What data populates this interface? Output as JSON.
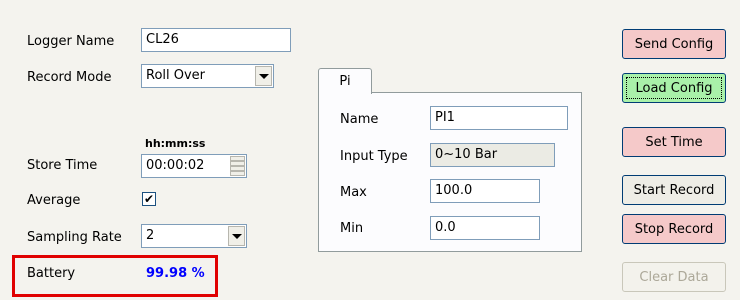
{
  "logger": {
    "name_label": "Logger Name",
    "name_value": "CL26",
    "record_mode_label": "Record Mode",
    "record_mode_value": "Roll Over",
    "time_format": "hh:mm:ss",
    "store_time_label": "Store Time",
    "store_time_value": "00:00:02",
    "average_label": "Average",
    "average_checked": "✔",
    "sampling_rate_label": "Sampling Rate",
    "sampling_rate_value": "2",
    "battery_label": "Battery",
    "battery_value": "99.98 %"
  },
  "tab": {
    "label": "Pi",
    "name_label": "Name",
    "name_value": "PI1",
    "input_type_label": "Input Type",
    "input_type_value": "0~10 Bar",
    "max_label": "Max",
    "max_value": "100.0",
    "min_label": "Min",
    "min_value": "0.0"
  },
  "buttons": {
    "send_config": "Send Config",
    "load_config": "Load Config",
    "set_time": "Set Time",
    "start_record": "Start Record",
    "stop_record": "Stop Record",
    "clear_data": "Clear Data"
  },
  "colors": {
    "battery_value": "#0000ff",
    "highlight_frame": "#e00000",
    "pink_button": "#f5c9c9",
    "green_button": "#a9f1a9"
  }
}
